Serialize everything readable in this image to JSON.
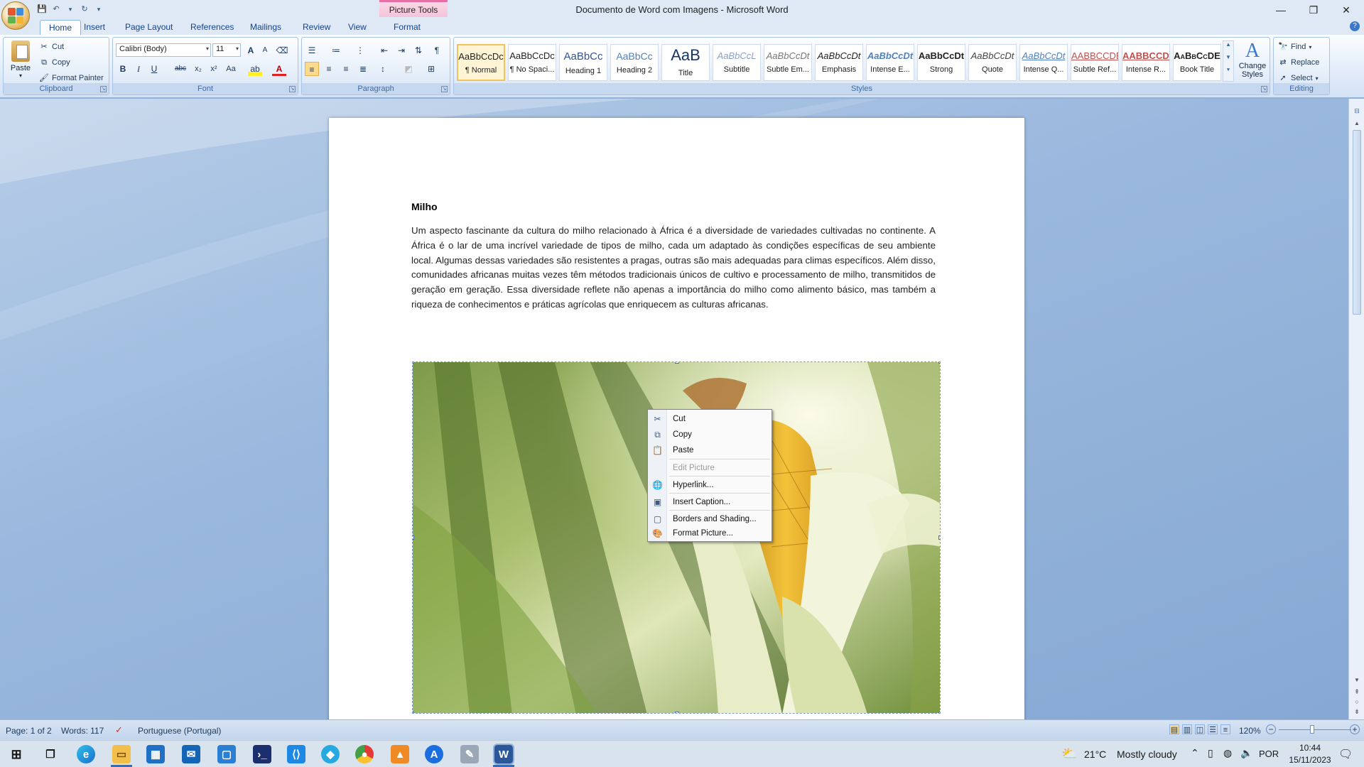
{
  "window": {
    "title": "Documento de Word com Imagens - Microsoft Word",
    "contextual_tab_group": "Picture Tools",
    "controls": {
      "minimize": "—",
      "restore": "❐",
      "close": "✕"
    }
  },
  "ribbon": {
    "tabs": [
      "Home",
      "Insert",
      "Page Layout",
      "References",
      "Mailings",
      "Review",
      "View",
      "Format"
    ],
    "active_tab": "Home",
    "clipboard": {
      "label": "Clipboard",
      "paste": "Paste",
      "cut": "Cut",
      "copy": "Copy",
      "format_painter": "Format Painter"
    },
    "font": {
      "label": "Font",
      "font_name": "Calibri (Body)",
      "font_size": "11",
      "bold": "B",
      "italic": "I",
      "underline": "U",
      "strike": "abc",
      "subscript": "x₂",
      "superscript": "x²",
      "change_case": "Aa",
      "grow": "A",
      "shrink": "A"
    },
    "paragraph": {
      "label": "Paragraph"
    },
    "styles": {
      "label": "Styles",
      "items": [
        {
          "sample": "AaBbCcDc",
          "name": "¶ Normal"
        },
        {
          "sample": "AaBbCcDc",
          "name": "¶ No Spaci..."
        },
        {
          "sample": "AaBbCc",
          "name": "Heading 1"
        },
        {
          "sample": "AaBbCc",
          "name": "Heading 2"
        },
        {
          "sample": "AaB",
          "name": "Title"
        },
        {
          "sample": "AaBbCcL",
          "name": "Subtitle"
        },
        {
          "sample": "AaBbCcDt",
          "name": "Subtle Em..."
        },
        {
          "sample": "AaBbCcDt",
          "name": "Emphasis"
        },
        {
          "sample": "AaBbCcDt",
          "name": "Intense E..."
        },
        {
          "sample": "AaBbCcDt",
          "name": "Strong"
        },
        {
          "sample": "AaBbCcDt",
          "name": "Quote"
        },
        {
          "sample": "AaBbCcDt",
          "name": "Intense Q..."
        },
        {
          "sample": "AABBCCDE",
          "name": "Subtle Ref..."
        },
        {
          "sample": "AABBCCDE",
          "name": "Intense R..."
        },
        {
          "sample": "AaBbCcDE",
          "name": "Book Title"
        }
      ],
      "change_styles": "Change Styles"
    },
    "editing": {
      "label": "Editing",
      "find": "Find",
      "replace": "Replace",
      "select": "Select"
    }
  },
  "document": {
    "heading": "Milho",
    "paragraph": "Um aspecto fascinante da cultura do milho relacionado à África é a diversidade de variedades cultivadas no continente. A África é o lar de uma incrível variedade de tipos de milho, cada um adaptado às condições específicas de seu ambiente local. Algumas dessas variedades são resistentes a pragas, outras são mais adequadas para climas específicos. Além disso, comunidades africanas muitas vezes têm métodos tradicionais únicos de cultivo e processamento de milho, transmitidos de geração em geração. Essa diversidade reflete não apenas a importância do milho como alimento básico, mas também a riqueza de conhecimentos e práticas agrícolas que enriquecem as culturas africanas."
  },
  "context_menu": {
    "items": [
      {
        "label": "Cut",
        "icon": "scissors-icon",
        "enabled": true
      },
      {
        "label": "Copy",
        "icon": "copy-icon",
        "enabled": true
      },
      {
        "label": "Paste",
        "icon": "paste-icon",
        "enabled": true
      },
      {
        "label": "Edit Picture",
        "icon": "",
        "enabled": false
      },
      {
        "label": "Hyperlink...",
        "icon": "globe-link-icon",
        "enabled": true
      },
      {
        "label": "Insert Caption...",
        "icon": "caption-icon",
        "enabled": true
      },
      {
        "label": "Borders and Shading...",
        "icon": "borders-icon",
        "enabled": true
      },
      {
        "label": "Format Picture...",
        "icon": "format-picture-icon",
        "enabled": true
      }
    ]
  },
  "statusbar": {
    "page": "Page: 1 of 2",
    "words": "Words: 117",
    "language": "Portuguese (Portugal)",
    "zoom": "120%"
  },
  "taskbar": {
    "weather_temp": "21°C",
    "weather_desc": "Mostly cloudy",
    "language": "POR",
    "time": "10:44",
    "date": "15/11/2023"
  },
  "colors": {
    "ribbon_accent": "#15428b",
    "picture_tools_accent": "#e66fa3",
    "workspace": "#9bb9de"
  }
}
